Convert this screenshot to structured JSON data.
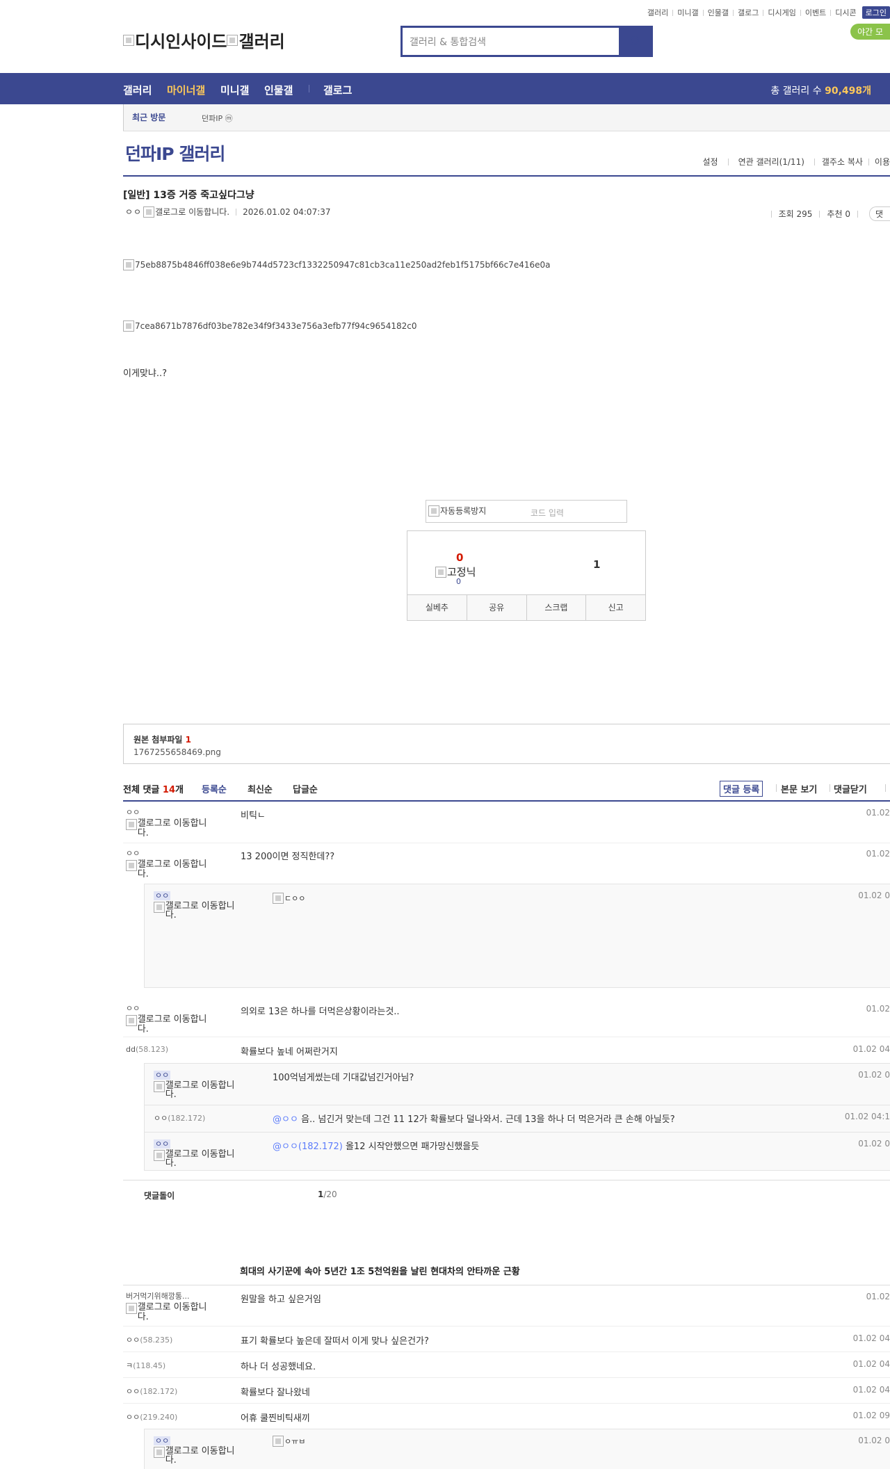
{
  "util_links": [
    "갤러리",
    "미니갤",
    "인물갤",
    "갤로그",
    "디시게임",
    "이벤트",
    "디시콘"
  ],
  "login_label": "로그인",
  "night_label": "야간 모",
  "logo": {
    "alt1": "디시인사이드",
    "alt2": "갤러리"
  },
  "search": {
    "placeholder": "갤러리 & 통합검색"
  },
  "nav": {
    "items": [
      "갤러리",
      "마이너갤",
      "미니갤",
      "인물갤",
      "갤로그"
    ],
    "count_label": "총 갤러리 수",
    "count_value": "90,498개"
  },
  "recent": {
    "label": "최근 방문",
    "gallery": "던파IP ⓜ"
  },
  "gallery": {
    "title": "던파IP 갤러리",
    "tools": [
      "설정",
      "연관 갤러리(1/11)",
      "갤주소 복사",
      "이용"
    ]
  },
  "post": {
    "title": "[일반] 13증 거증 죽고싶다그냥",
    "author": "ㅇㅇ",
    "gallog_alt": "갤로그로 이동합니다.",
    "date": "2026.01.02 04:07:37",
    "views": "조회 295",
    "recommend": "추천 0",
    "comment_btn": "댓",
    "images": [
      "75eb8875b4846ff038e6e9b744d5723cf1332250947c81cb3ca11e250ad2feb1f5175bf66c7e416e0a",
      "7cea8671b7876df03be782e34f9f3433e756a3efb77f94c9654182c0"
    ],
    "text": "이게맞냐..?"
  },
  "captcha": {
    "alt": "자동등록방지",
    "placeholder": "코드 입력"
  },
  "rec": {
    "up": "0",
    "fix_alt": "고정닉",
    "fix_count": "0",
    "down": "1",
    "buttons": [
      "실베추",
      "공유",
      "스크랩",
      "신고"
    ]
  },
  "attach": {
    "label": "원본 첨부파일",
    "count": "1",
    "file": "1767255658469.png"
  },
  "comments": {
    "all_label": "전체 댓글",
    "all_count": "14",
    "all_unit": "개",
    "sorts": [
      "등록순",
      "최신순",
      "답글순"
    ],
    "register": "댓글 등록",
    "view_body": "본문 보기",
    "close": "댓글닫기",
    "gallog_alt": "갤로그로 이동합니다.",
    "rows": [
      {
        "nick": "ㅇㅇ",
        "text": "비틱ㄴ",
        "date": "01.02"
      },
      {
        "nick": "ㅇㅇ",
        "text": "13 200이면 정직한데??",
        "date": "01.02"
      },
      {
        "nick": "ㅇㅇ",
        "text": "ㄷㅇㅇ",
        "date": "01.02 0"
      },
      {
        "nick": "ㅇㅇ",
        "text": "의외로 13은 하나를 더먹은상황이라는것..",
        "date": "01.02"
      },
      {
        "nick": "dd",
        "ip": "(58.123)",
        "text": "확률보다 높네 어쩌란거지",
        "date": "01.02 04"
      },
      {
        "nick": "ㅇㅇ",
        "text": "100억넘게썼는데 기대값넘긴거아님?",
        "date": "01.02 0"
      },
      {
        "nick": "ㅇㅇ",
        "ip": "(182.172)",
        "at": "@ㅇㅇ",
        "text": "음.. 넘긴거 맞는데 그건 11 12가 확률보다 덜나와서. 근데 13을 하나 더 먹은거라 큰 손해 아닐듯?",
        "date": "01.02 04:1"
      },
      {
        "nick": "ㅇㅇ",
        "at": "@ㅇㅇ(182.172)",
        "text": "올12 시작안했으면 패가망신했을듯",
        "date": "01.02 0"
      }
    ],
    "page_label": "댓글돌이",
    "page_cur": "1",
    "page_total": "/20",
    "ad_title": "희대의 사기꾼에 속아 5년간 1조 5천억원을 날린 현대차의 안타까운 근황",
    "rows2": [
      {
        "nick": "버거먹기위해깡통...",
        "text": "원말을 하고 싶은거임",
        "date": "01.02"
      },
      {
        "nick": "ㅇㅇ",
        "ip": "(58.235)",
        "text": "표기 확률보다 높은데 잘떠서 이게 맞나 싶은건가?",
        "date": "01.02 04"
      },
      {
        "nick": "ㅋ",
        "ip": "(118.45)",
        "text": "하나 더 성공했네요.",
        "date": "01.02 04"
      },
      {
        "nick": "ㅇㅇ",
        "ip": "(182.172)",
        "text": "확률보다 잘나왔네",
        "date": "01.02 04"
      },
      {
        "nick": "ㅇㅇ",
        "ip": "(219.240)",
        "text": "어휴 쿨찐비틱새끼",
        "date": "01.02 09"
      },
      {
        "nick": "ㅇㅇ",
        "text": "ㅇㅠㅂ",
        "date": "01.02 0"
      }
    ]
  }
}
